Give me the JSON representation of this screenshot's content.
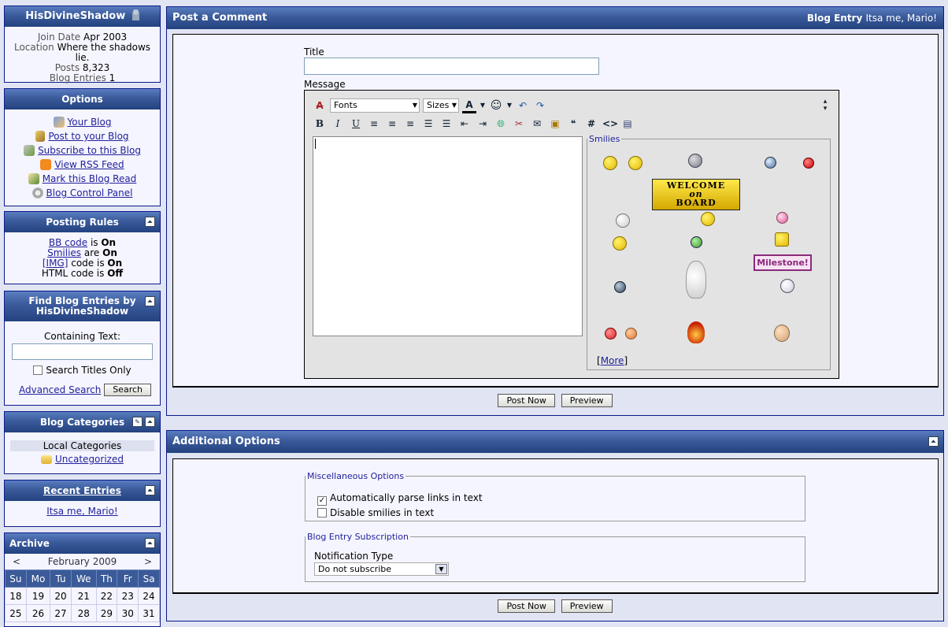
{
  "profile": {
    "username": "HisDivineShadow",
    "join_label": "Join Date",
    "join_value": "Apr 2003",
    "location_label": "Location",
    "location_value": "Where the shadows lie.",
    "posts_label": "Posts",
    "posts_value": "8,323",
    "entries_label": "Blog Entries",
    "entries_value": "1"
  },
  "options": {
    "title": "Options",
    "items": [
      "Your Blog",
      "Post to your Blog",
      "Subscribe to this Blog",
      "View RSS Feed",
      "Mark this Blog Read",
      "Blog Control Panel"
    ]
  },
  "rules": {
    "title": "Posting Rules",
    "bb_link": "BB code",
    "bb_text": "is",
    "bb_state": "On",
    "smilies_link": "Smilies",
    "smilies_text": "are",
    "smilies_state": "On",
    "img_link": "[IMG]",
    "img_text": "code is",
    "img_state": "On",
    "html_text": "HTML code is",
    "html_state": "Off"
  },
  "find": {
    "title_line1": "Find Blog Entries by",
    "title_line2": "HisDivineShadow",
    "containing_label": "Containing Text:",
    "search_titles": "Search Titles Only",
    "advanced": "Advanced Search",
    "search_btn": "Search"
  },
  "categories": {
    "title": "Blog Categories",
    "local": "Local Categories",
    "item": "Uncategorized"
  },
  "recent": {
    "title": "Recent Entries",
    "item": "Itsa me, Mario!"
  },
  "archive": {
    "title": "Archive",
    "prev": "<",
    "next": ">",
    "month": "February 2009",
    "days": [
      "Su",
      "Mo",
      "Tu",
      "We",
      "Th",
      "Fr",
      "Sa"
    ],
    "week1": [
      "18",
      "19",
      "20",
      "21",
      "22",
      "23",
      "24"
    ],
    "week2": [
      "25",
      "26",
      "27",
      "28",
      "29",
      "30",
      "31"
    ]
  },
  "comment": {
    "header": "Post a Comment",
    "blog_entry_label": "Blog Entry",
    "blog_entry_title": "Itsa me, Mario!",
    "title_label": "Title",
    "message_label": "Message",
    "fonts": "Fonts",
    "sizes": "Sizes",
    "smilies_legend": "Smilies",
    "more_link": "More",
    "welcome_line1": "WELCOME",
    "welcome_line2": "on",
    "welcome_line3": "BOARD",
    "milestone": "Milestone!",
    "post_btn": "Post Now",
    "preview_btn": "Preview"
  },
  "additional": {
    "header": "Additional Options",
    "misc_legend": "Miscellaneous Options",
    "parse_links": "Automatically parse links in text",
    "disable_smilies": "Disable smilies in text",
    "sub_legend": "Blog Entry Subscription",
    "notification_label": "Notification Type",
    "notification_value": "Do not subscribe",
    "post_btn": "Post Now",
    "preview_btn": "Preview"
  }
}
